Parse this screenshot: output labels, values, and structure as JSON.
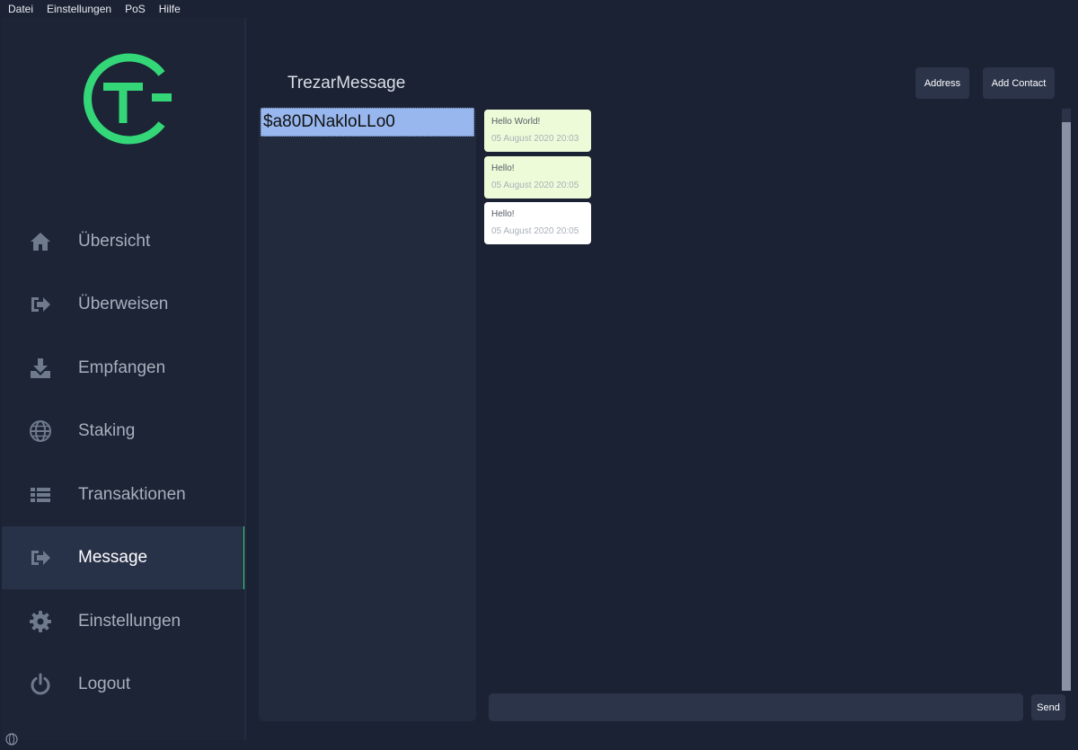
{
  "menu": [
    "Datei",
    "Einstellungen",
    "PoS",
    "Hilfe"
  ],
  "colors": {
    "accent": "#34d778",
    "background": "#1b2233",
    "selection": "#97b7ee"
  },
  "nav": {
    "items": [
      {
        "label": "Übersicht",
        "icon": "home-icon"
      },
      {
        "label": "Überweisen",
        "icon": "send-icon"
      },
      {
        "label": "Empfangen",
        "icon": "download-icon"
      },
      {
        "label": "Staking",
        "icon": "globe-icon"
      },
      {
        "label": "Transaktionen",
        "icon": "list-icon"
      },
      {
        "label": "Message",
        "icon": "message-icon",
        "active": true
      },
      {
        "label": "Einstellungen",
        "icon": "gear-icon"
      },
      {
        "label": "Logout",
        "icon": "power-icon"
      }
    ]
  },
  "page": {
    "title": "TrezarMessage"
  },
  "buttons": {
    "address": "Address",
    "add_contact": "Add Contact",
    "send": "Send"
  },
  "contacts": [
    "$a80DNakloLLo0"
  ],
  "messages": [
    {
      "text": "Hello World!",
      "time": "05 August 2020 20:03",
      "direction": "sent"
    },
    {
      "text": "Hello!",
      "time": "05 August 2020 20:05",
      "direction": "sent"
    },
    {
      "text": "Hello!",
      "time": "05 August 2020 20:05",
      "direction": "received"
    }
  ],
  "input": {
    "value": "",
    "placeholder": ""
  }
}
